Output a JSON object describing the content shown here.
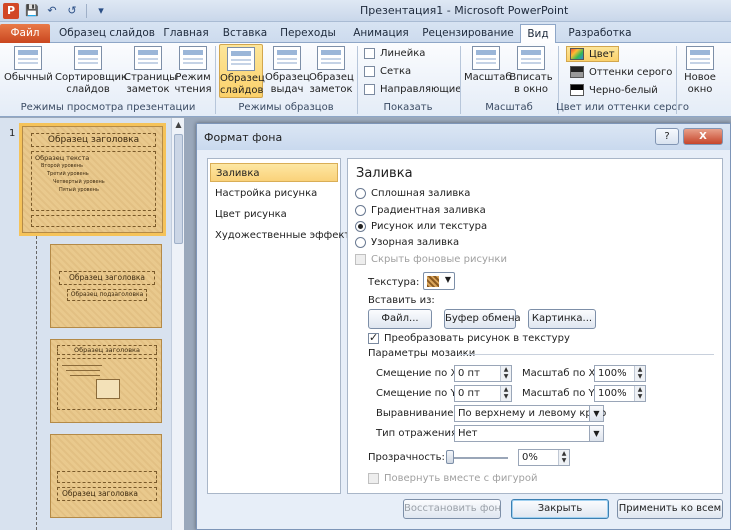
{
  "window": {
    "title": "Презентация1 - Microsoft PowerPoint",
    "app_icon": "P"
  },
  "ribbon_tabs": {
    "file": "Файл",
    "items": [
      "Образец слайдов",
      "Главная",
      "Вставка",
      "Переходы",
      "Анимация",
      "Рецензирование",
      "Вид",
      "Разработка"
    ],
    "active": "Вид"
  },
  "ribbon": {
    "view_modes": {
      "buttons": [
        "Обычный",
        "Сортировщик слайдов",
        "Страницы заметок",
        "Режим чтения"
      ],
      "buttons_lines": [
        [
          "Обычный",
          ""
        ],
        [
          "Сортировщик",
          "слайдов"
        ],
        [
          "Страницы",
          "заметок"
        ],
        [
          "Режим",
          "чтения"
        ]
      ],
      "label": "Режимы просмотра презентации"
    },
    "master_views": {
      "buttons_lines": [
        [
          "Образец",
          "слайдов"
        ],
        [
          "Образец",
          "выдач"
        ],
        [
          "Образец",
          "заметок"
        ]
      ],
      "label": "Режимы образцов"
    },
    "show": {
      "checkboxes": [
        "Линейка",
        "Сетка",
        "Направляющие"
      ],
      "label": "Показать"
    },
    "zoom": {
      "buttons_lines": [
        [
          "Масштаб",
          ""
        ],
        [
          "Вписать",
          "в окно"
        ]
      ],
      "label": "Масштаб"
    },
    "color": {
      "options": [
        "Цвет",
        "Оттенки серого",
        "Черно-белый"
      ],
      "selected": "Цвет",
      "label": "Цвет или оттенки серого"
    },
    "window": {
      "button_lines": [
        "Новое",
        "окно"
      ]
    }
  },
  "slides_panel": {
    "first_number": "1",
    "master_title": "Образец заголовка",
    "master_text": "Образец текста",
    "levels": [
      "Второй уровень",
      "Третий уровень",
      "Четвертый уровень",
      "Пятый уровень"
    ],
    "layout_title": "Образец заголовка",
    "layout_subtitle": "Образец подзаголовка"
  },
  "dialog": {
    "title": "Формат фона",
    "help_button": "?",
    "close_button": "X",
    "nav": [
      "Заливка",
      "Настройка рисунка",
      "Цвет рисунка",
      "Художественные эффекты"
    ],
    "nav_selected": "Заливка",
    "heading": "Заливка",
    "fill_options": [
      "Сплошная заливка",
      "Градиентная заливка",
      "Рисунок или текстура",
      "Узорная заливка"
    ],
    "fill_selected": "Рисунок или текстура",
    "hide_bg": "Скрыть фоновые рисунки",
    "texture_label": "Текстура:",
    "insert_from_label": "Вставить из:",
    "insert_buttons": [
      "Файл...",
      "Буфер обмена",
      "Картинка..."
    ],
    "tile_checkbox": "Преобразовать рисунок в текстуру",
    "tile_params_label": "Параметры мозаики",
    "offset_x_label": "Смещение по X:",
    "offset_x_value": "0 пт",
    "offset_y_label": "Смещение по Y:",
    "offset_y_value": "0 пт",
    "scale_x_label": "Масштаб по X:",
    "scale_x_value": "100%",
    "scale_y_label": "Масштаб по Y:",
    "scale_y_value": "100%",
    "align_label": "Выравнивание:",
    "align_value": "По верхнему и левому краю",
    "mirror_label": "Тип отражения:",
    "mirror_value": "Нет",
    "transparency_label": "Прозрачность:",
    "transparency_value": "0%",
    "transparency_level": 0,
    "rotate_with_shape": "Повернуть вместе с фигурой",
    "buttons": {
      "reset": "Восстановить фон",
      "close": "Закрыть",
      "apply_all": "Применить ко всем"
    }
  }
}
